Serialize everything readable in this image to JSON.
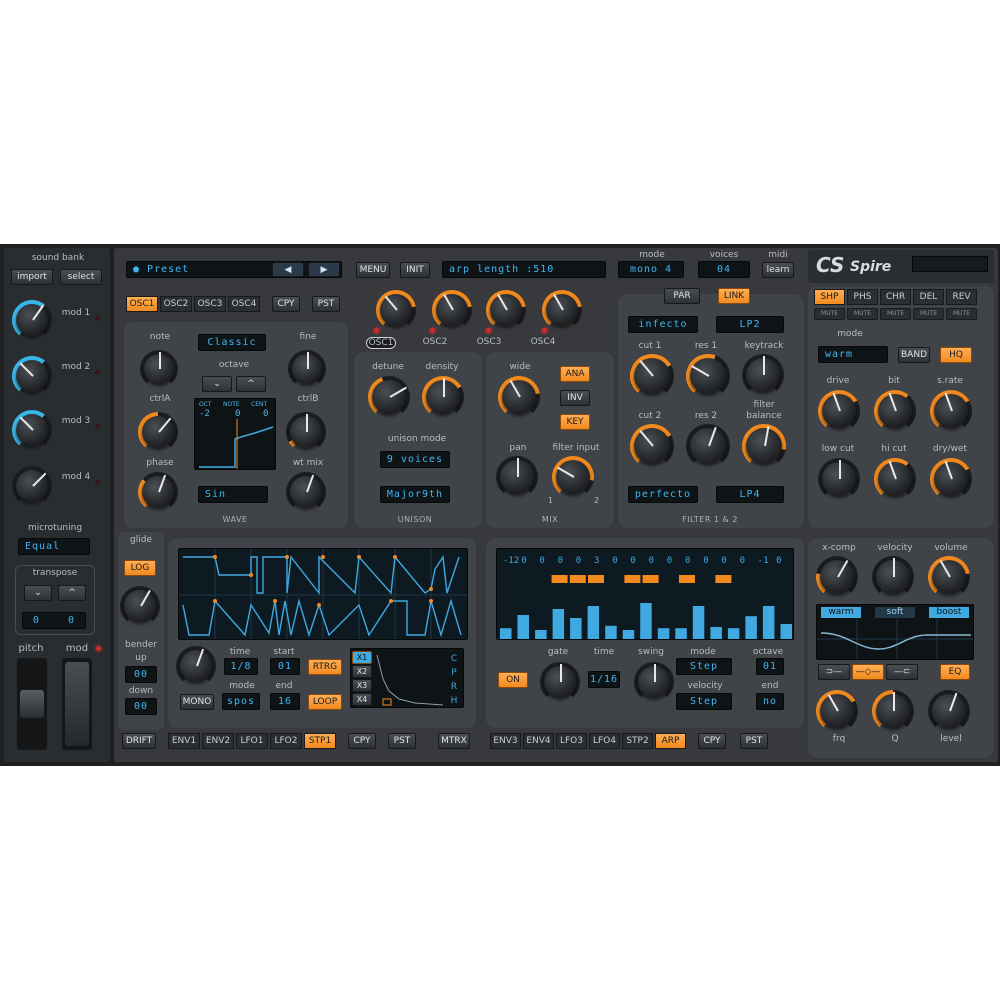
{
  "sidebar": {
    "title": "sound bank",
    "import": "import",
    "select": "select",
    "mods": [
      "mod 1",
      "mod 2",
      "mod 3",
      "mod 4"
    ],
    "microtuning_label": "microtuning",
    "microtuning_value": "Equal",
    "transpose_label": "transpose",
    "transpose_down": "⌄",
    "transpose_up": "^",
    "transpose_values": [
      "0",
      "0"
    ],
    "pitch": "pitch",
    "mod": "mod"
  },
  "header": {
    "preset": "Preset",
    "menu": "MENU",
    "init": "INIT",
    "arp_length": "arp length  :510",
    "mode_label": "mode",
    "mode_value": "mono 4",
    "voices_label": "voices",
    "voices_value": "04",
    "midi_label": "midi",
    "midi_value": "learn",
    "brand": "Spire"
  },
  "osc": {
    "tabs": [
      "OSC1",
      "OSC2",
      "OSC3",
      "OSC4"
    ],
    "cpy": "CPY",
    "pst": "PST",
    "knob_labels": [
      "OSC1",
      "OSC2",
      "OSC3",
      "OSC4"
    ]
  },
  "wave": {
    "note": "note",
    "fine": "fine",
    "classic": "Classic",
    "octave": "octave",
    "oct_down": "⌄",
    "oct_up": "^",
    "ctrlA": "ctrlA",
    "ctrlB": "ctrlB",
    "phase": "phase",
    "wt_mix": "wt mix",
    "wave_value": "Sin",
    "title": "WAVE",
    "disp_oct": "OCT",
    "disp_note": "NOTE",
    "disp_cent": "CENT",
    "disp_vals": [
      "-2",
      "0",
      "0"
    ]
  },
  "unison": {
    "detune": "detune",
    "density": "density",
    "mode_label": "unison mode",
    "voices": "9 voices",
    "chord": "Major9th",
    "title": "UNISON"
  },
  "mix": {
    "wide": "wide",
    "ana": "ANA",
    "inv": "INV",
    "key": "KEY",
    "pan": "pan",
    "filter_input": "filter input",
    "in1": "1",
    "in2": "2",
    "title": "MIX"
  },
  "filter": {
    "par": "PAR",
    "link": "LINK",
    "type1": "infecto",
    "slope1": "LP2",
    "cut1": "cut 1",
    "res1": "res 1",
    "keytrack": "keytrack",
    "cut2": "cut 2",
    "res2": "res 2",
    "balance": "filter\nbalance",
    "type2": "perfecto",
    "slope2": "LP4",
    "title": "FILTER 1 & 2"
  },
  "fx": {
    "tabs": [
      "SHP",
      "PHS",
      "CHR",
      "DEL",
      "REV"
    ],
    "mute": "MUTE",
    "mode": "mode",
    "mode_value": "warm",
    "band": "BAND",
    "hq": "HQ",
    "drive": "drive",
    "bit": "bit",
    "srate": "s.rate",
    "low_cut": "low cut",
    "hi_cut": "hi cut",
    "dry_wet": "dry/wet"
  },
  "glide": {
    "label": "glide",
    "log": "LOG",
    "bender": "bender",
    "up": "up",
    "up_val": "00",
    "down": "down",
    "down_val": "00",
    "drift": "DRIFT",
    "mono": "MONO"
  },
  "mod_left": {
    "time": "time",
    "start": "start",
    "time_val": "1/8",
    "start_val": "01",
    "rtrg": "RTRG",
    "mode": "mode",
    "end": "end",
    "mode_val": "spos",
    "end_val": "16",
    "loop": "LOOP",
    "xs": [
      "X1",
      "X2",
      "X3",
      "X4"
    ],
    "cprh": [
      "C",
      "P",
      "R",
      "H"
    ],
    "tabs": [
      "ENV1",
      "ENV2",
      "LFO1",
      "LFO2",
      "STP1"
    ],
    "cpy": "CPY",
    "pst": "PST",
    "mtrx": "MTRX"
  },
  "arp": {
    "steps": [
      "-12",
      "0",
      "0",
      "0",
      "0",
      "3",
      "0",
      "0",
      "0",
      "0",
      "0",
      "0",
      "0",
      "0",
      "-1",
      "0"
    ],
    "bars": [
      0.18,
      0.4,
      0.15,
      0.5,
      0.35,
      0.55,
      0.22,
      0.15,
      0.6,
      0.18,
      0.18,
      0.55,
      0.2,
      0.18,
      0.38,
      0.55,
      0.25
    ],
    "on": "ON",
    "gate": "gate",
    "time": "time",
    "time_val": "1/16",
    "swing": "swing",
    "mode": "mode",
    "mode_val": "Step",
    "octave": "octave",
    "octave_val": "01",
    "velocity": "velocity",
    "velocity_val": "Step",
    "end": "end",
    "end_val": "no",
    "tabs": [
      "ENV3",
      "ENV4",
      "LFO3",
      "LFO4",
      "STP2",
      "ARP"
    ],
    "cpy": "CPY",
    "pst": "PST"
  },
  "eq": {
    "xcomp": "x-comp",
    "velocity": "velocity",
    "volume": "volume",
    "warm": "warm",
    "soft": "soft",
    "boost": "boost",
    "eq": "EQ",
    "frq": "frq",
    "q": "Q",
    "level": "level"
  }
}
